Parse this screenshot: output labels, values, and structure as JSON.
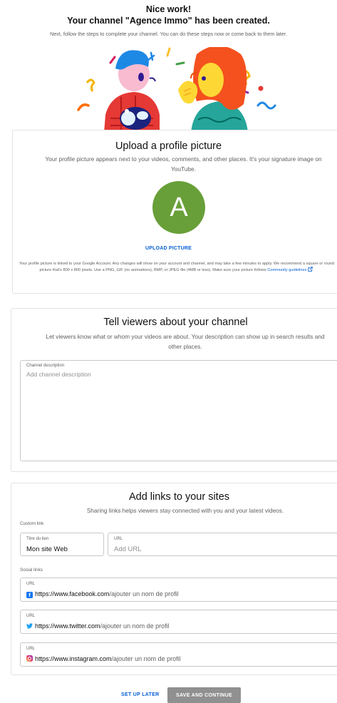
{
  "header": {
    "line1": "Nice work!",
    "line2": "Your channel \"Agence Immo\" has been created.",
    "subtitle": "Next, follow the steps to complete your channel. You can do these steps now or come back to them later."
  },
  "profile_picture": {
    "title": "Upload a profile picture",
    "description": "Your profile picture appears next to your videos, comments, and other places. It's your signature image on YouTube.",
    "avatar_letter": "A",
    "avatar_color": "#689f38",
    "upload_label": "UPLOAD PICTURE",
    "fine_print": "Your profile picture is linked to your Google Account. Any changes will show on your account and channel, and may take a few minutes to apply. We recommend a square or round picture that's 800 x 800 pixels. Use a PNG, GIF (no animations), BMP, or JPEG file (4MB or less). Make sure your picture follows",
    "guidelines_link": "Community guidelines"
  },
  "about": {
    "title": "Tell viewers about your channel",
    "description": "Let viewers know what or whom your videos are about. Your description can show up in search results and other places.",
    "field_label": "Channel description",
    "field_placeholder": "Add channel description"
  },
  "links": {
    "title": "Add links to your sites",
    "description": "Sharing links helps viewers stay connected with you and your latest videos.",
    "custom_label": "Custom link",
    "link_title_label": "Titre du lien",
    "link_title_value": "Mon site Web",
    "url_label": "URL",
    "url_placeholder": "Add URL",
    "social_label": "Social links",
    "social": [
      {
        "label": "URL",
        "icon": "facebook-icon",
        "prefix": "https://www.facebook.com",
        "suffix": "/ajouter un nom de profil"
      },
      {
        "label": "URL",
        "icon": "twitter-icon",
        "prefix": "https://www.twitter.com",
        "suffix": "/ajouter un nom de profil"
      },
      {
        "label": "URL",
        "icon": "instagram-icon",
        "prefix": "https://www.instagram.com",
        "suffix": "/ajouter un nom de profil"
      }
    ]
  },
  "footer": {
    "later_label": "SET UP LATER",
    "save_label": "SAVE AND CONTINUE"
  },
  "colors": {
    "accent": "#065fd4",
    "save_button": "#909090"
  }
}
